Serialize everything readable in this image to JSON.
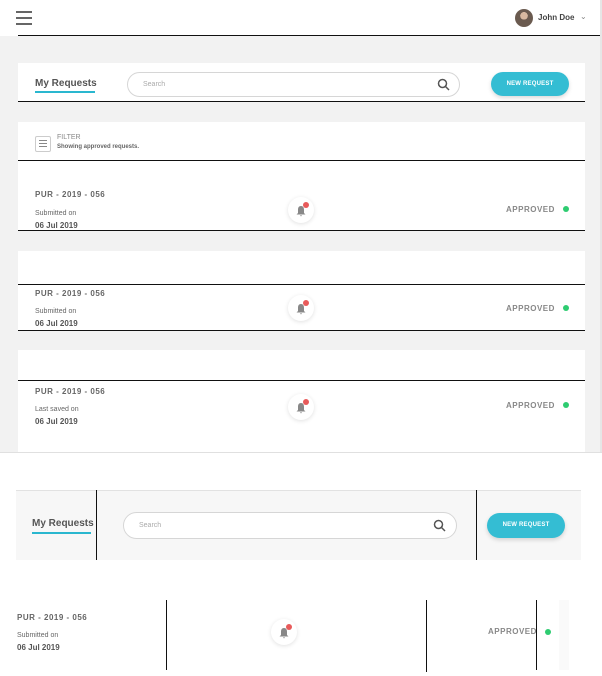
{
  "header": {
    "menu_icon": "hamburger-icon",
    "user_name": "John Doe",
    "dropdown_icon": "chevron-down-icon"
  },
  "toolbar": {
    "tab_label": "My Requests",
    "search_placeholder": "Search",
    "new_request_label": "NEW REQUEST"
  },
  "filter": {
    "title": "FILTER",
    "subtitle": "Showing approved requests."
  },
  "requests": [
    {
      "code": "PUR - 2019 - 056",
      "date_label": "Submitted on",
      "date": "06 Jul 2019",
      "status": "APPROVED",
      "notification_count": "1"
    },
    {
      "code": "PUR - 2019 - 056",
      "date_label": "Submitted on",
      "date": "06 Jul 2019",
      "status": "APPROVED",
      "notification_count": "1"
    },
    {
      "code": "PUR - 2019 - 056",
      "date_label": "Last saved on",
      "date": "06 Jul 2019",
      "status": "APPROVED",
      "notification_count": "1"
    }
  ],
  "zoom_toolbar": {
    "tab_label": "My Requests",
    "search_placeholder": "Search",
    "new_request_label": "NEW REQUEST"
  },
  "zoom_request": {
    "code": "PUR - 2019 - 056",
    "date_label": "Submitted on",
    "date": "06 Jul 2019",
    "status": "APPROVED",
    "notification_count": "1"
  },
  "colors": {
    "accent": "#34bdd3",
    "status_ok": "#2ecc71",
    "badge": "#e85a5a"
  }
}
